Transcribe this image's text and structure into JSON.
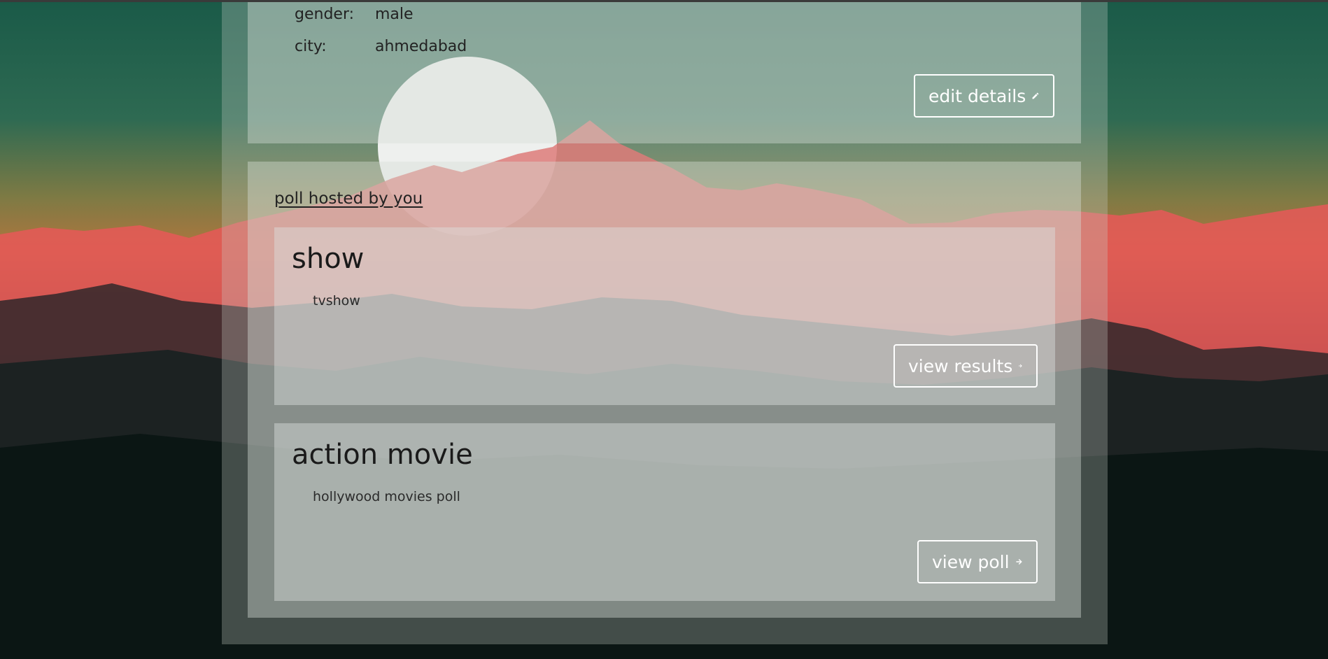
{
  "profile": {
    "fields": [
      {
        "label": "gender:",
        "value": "male"
      },
      {
        "label": "city:",
        "value": "ahmedabad"
      }
    ],
    "edit_label": "edit details",
    "edit_icon": "pencil-icon"
  },
  "polls": {
    "section_title": "poll hosted by you",
    "items": [
      {
        "title": "show",
        "description": "tvshow",
        "action_label": "view results",
        "action_icon": "arrow-right-icon"
      },
      {
        "title": "action movie",
        "description": "hollywood movies poll",
        "action_label": "view poll",
        "action_icon": "arrow-right-icon"
      }
    ]
  },
  "colors": {
    "sky_top": "#1e5a4a",
    "mountain_red": "#e64848",
    "dark_ground": "#0b1614",
    "button_border": "#ffffff"
  }
}
